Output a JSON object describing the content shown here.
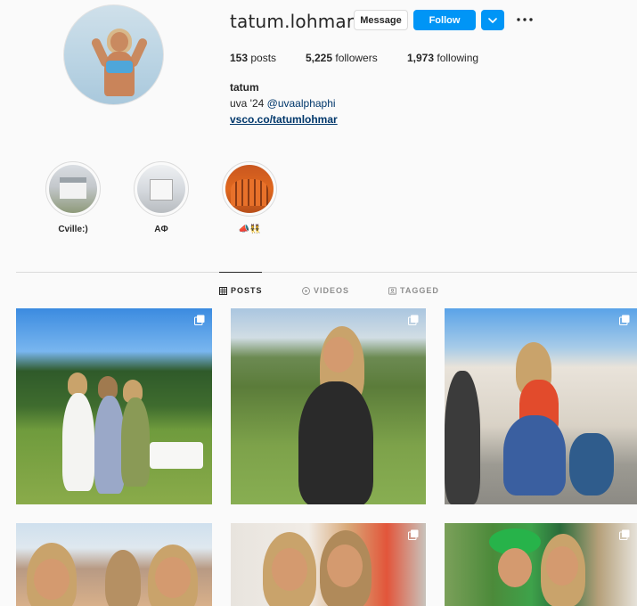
{
  "profile": {
    "username": "tatum.lohmar",
    "full_name": "tatum",
    "bio_prefix": "uva '24 ",
    "bio_mention": "@uvaalphaphi",
    "website": "vsco.co/tatumlohmar",
    "stats": {
      "posts_count": "153",
      "posts_label": "posts",
      "followers_count": "5,225",
      "followers_label": "followers",
      "following_count": "1,973",
      "following_label": "following"
    }
  },
  "actions": {
    "message_label": "Message",
    "follow_label": "Follow",
    "dropdown_icon": "chevron-down-icon",
    "more_icon": "more-options-icon"
  },
  "highlights": [
    {
      "label": "Cville:)"
    },
    {
      "label": "AΦ"
    },
    {
      "label": "📣👯"
    }
  ],
  "tabs": [
    {
      "label": "POSTS",
      "icon": "grid-icon",
      "active": true
    },
    {
      "label": "VIDEOS",
      "icon": "play-circle-icon",
      "active": false
    },
    {
      "label": "TAGGED",
      "icon": "tag-person-icon",
      "active": false
    }
  ],
  "posts": [
    {
      "multi_image": true
    },
    {
      "multi_image": true
    },
    {
      "multi_image": true
    },
    {
      "multi_image": false
    },
    {
      "multi_image": true
    },
    {
      "multi_image": true
    }
  ],
  "colors": {
    "accent": "#0095f6",
    "link": "#00376b",
    "text": "#262626",
    "muted": "#8e8e8e",
    "background": "#fafafa"
  }
}
